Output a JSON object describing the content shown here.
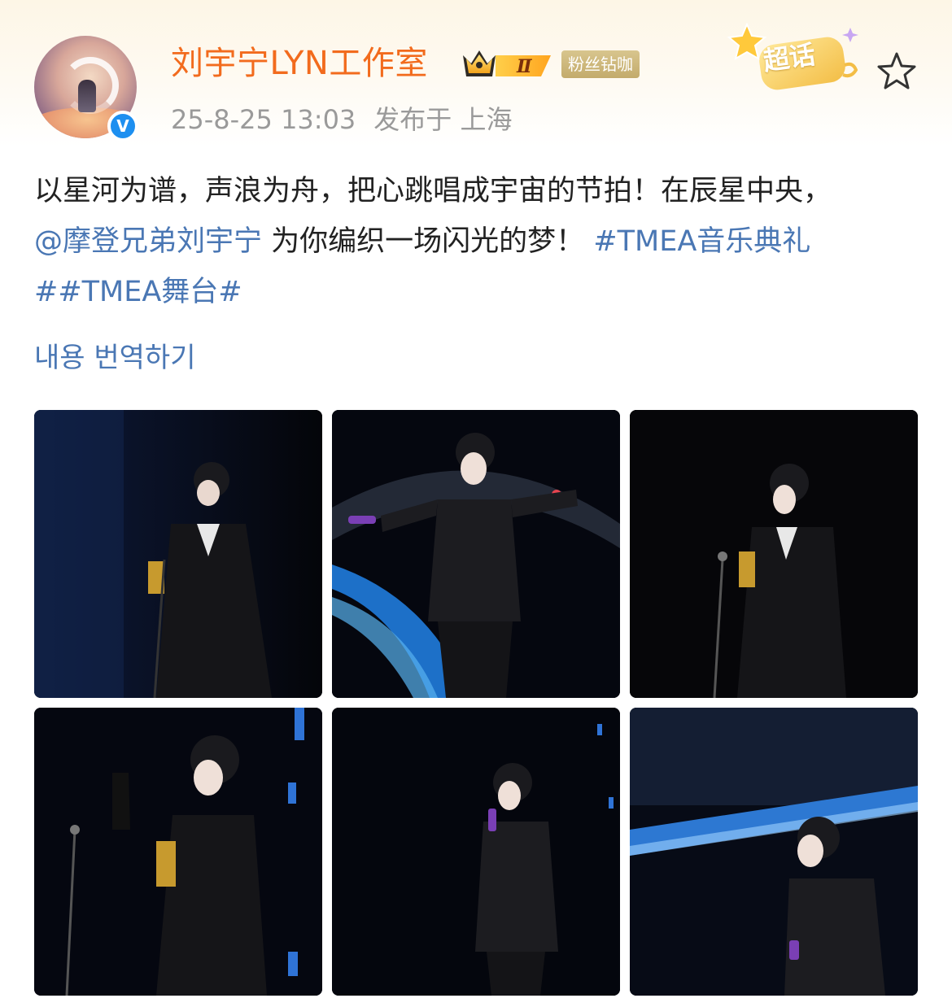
{
  "post": {
    "author": "刘宇宁LYN工作室",
    "level_badge": "Ⅱ",
    "fan_badge": "粉丝钻咖",
    "date": "25-8-25 13:03",
    "location": "发布于 上海",
    "chaohua_label": "超话",
    "text_part1": "以星河为谱，声浪为舟，把心跳唱成宇宙的节拍！在辰星中央，",
    "mention": "@摩登兄弟刘宇宁",
    "text_part2": " 为你编织一场闪光的梦！",
    "hashtag1": "#TMEA音乐典礼",
    "hashtag2": "##TMEA舞台#",
    "translate_label": "내용 번역하기"
  },
  "colors": {
    "username": "#f26b1d",
    "link": "#4a77b4",
    "meta": "#9a9a9a",
    "verified": "#1d8ff0",
    "fan_badge": "#c9b274"
  },
  "icons": {
    "verified": "verified-v-icon",
    "crown": "crown-icon",
    "star": "star-outline-icon",
    "chaohua": "chaohua-star-icon"
  },
  "photos": [
    {
      "name": "photo-1"
    },
    {
      "name": "photo-2"
    },
    {
      "name": "photo-3"
    },
    {
      "name": "photo-4"
    },
    {
      "name": "photo-5"
    },
    {
      "name": "photo-6"
    }
  ]
}
